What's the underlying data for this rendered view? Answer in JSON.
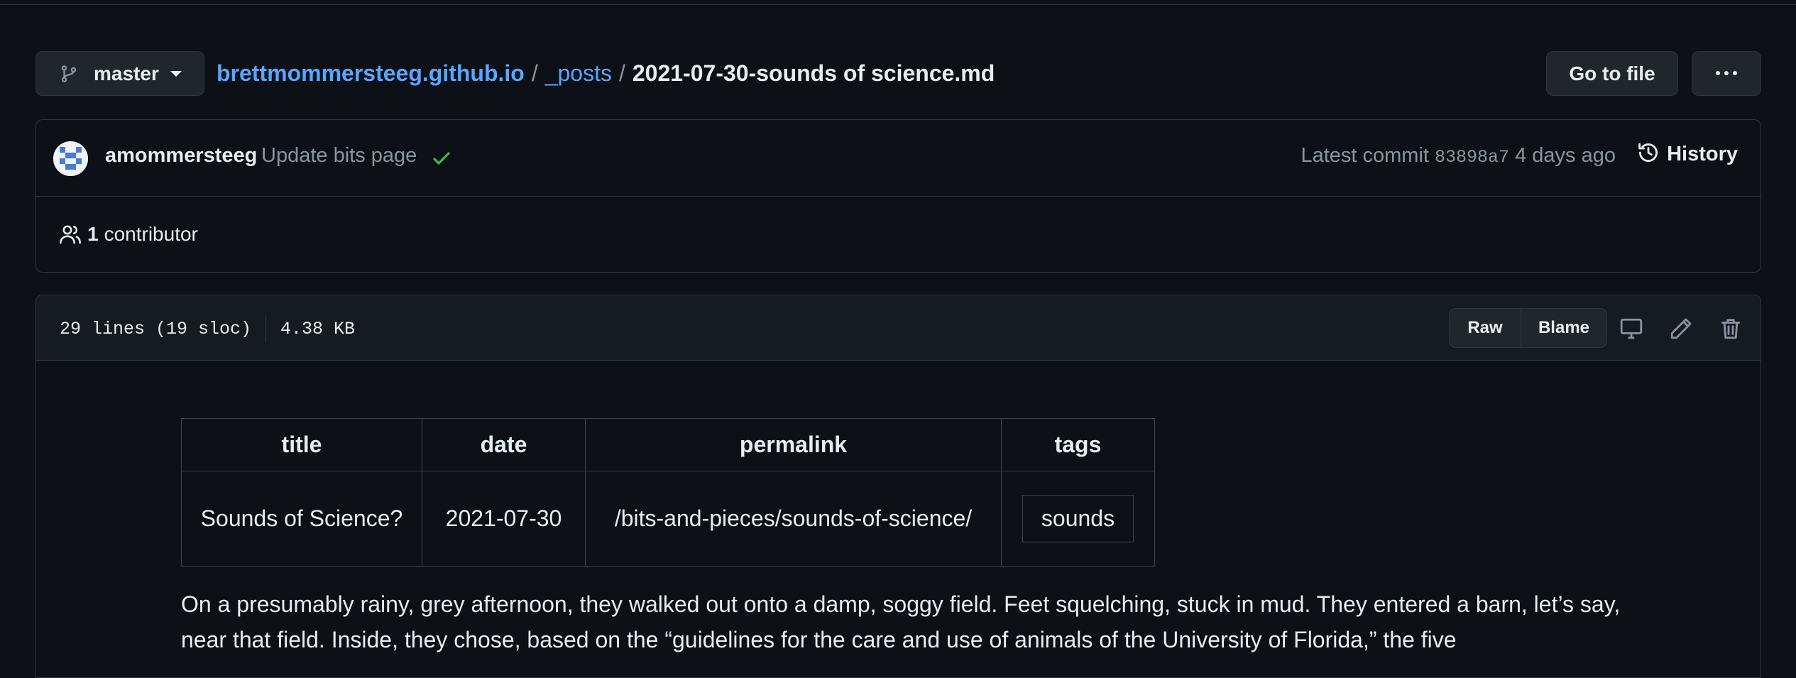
{
  "branch": {
    "name": "master",
    "icon": "git-branch-icon"
  },
  "breadcrumb": {
    "repo": "brettmommersteeg.github.io",
    "separator": "/",
    "folder": "_posts",
    "file": "2021-07-30-sounds of science.md"
  },
  "actions": {
    "go_to_file": "Go to file",
    "more": "more-horizontal-icon"
  },
  "commit": {
    "author": "amommersteeg",
    "message": "Update bits page",
    "status_icon": "check-icon",
    "status_color": "#3fb950",
    "latest_label": "Latest commit",
    "sha": "83898a7",
    "age": "4 days ago",
    "history_label": "History"
  },
  "contributors": {
    "count": "1",
    "label": "contributor"
  },
  "file_header": {
    "lines": "29 lines (19 sloc)",
    "size": "4.38 KB",
    "raw_label": "Raw",
    "blame_label": "Blame",
    "icons": [
      "desktop-icon",
      "pencil-icon",
      "trash-icon"
    ]
  },
  "front_matter": {
    "headers": [
      "title",
      "date",
      "permalink",
      "tags"
    ],
    "row": {
      "title": "Sounds of Science?",
      "date": "2021-07-30",
      "permalink": "/bits-and-pieces/sounds-of-science/",
      "tag": "sounds"
    }
  },
  "paragraph": "On a presumably rainy, grey afternoon, they walked out onto a damp, soggy field. Feet squelching, stuck in mud. They entered a barn, let’s say, near that field. Inside, they chose, based on the “guidelines for the care and use of animals of the University of Florida,” the five",
  "colors": {
    "background": "#0d1117",
    "link": "#58a6ff",
    "border": "#30363d",
    "muted": "#8b949e"
  }
}
